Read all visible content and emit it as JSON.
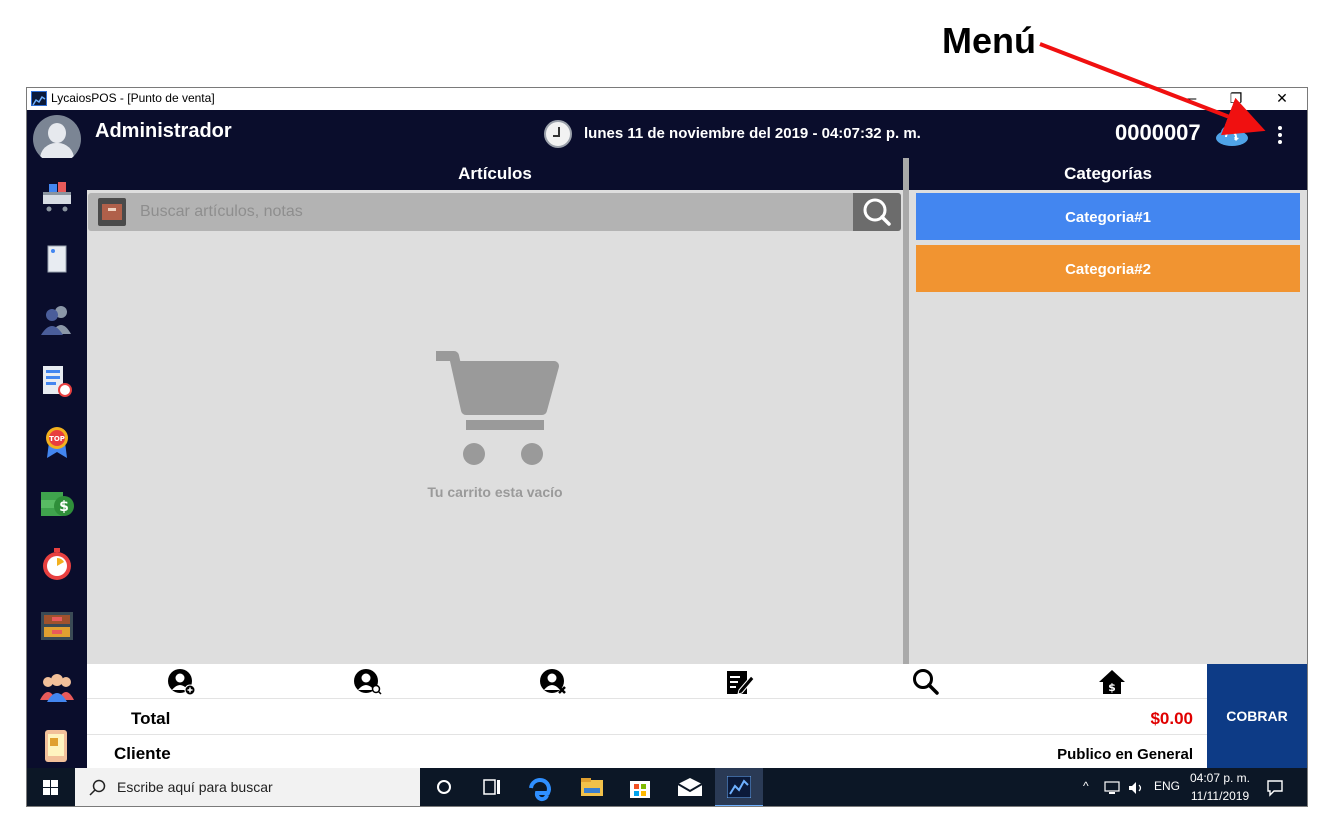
{
  "annotation": {
    "label": "Menú"
  },
  "window": {
    "title": "LycaiosPOS - [Punto de venta]",
    "controls": {
      "minimize": "—",
      "maximize": "❐",
      "close": "✕"
    }
  },
  "header": {
    "user": "Administrador",
    "datetime": "lunes 11 de noviembre del 2019 - 04:07:32 p. m.",
    "ticket_number": "0000007"
  },
  "sidebar": {
    "items": [
      "shopping-cart-icon",
      "document-icon",
      "users-icon",
      "report-clock-icon",
      "top-badge-icon",
      "money-icon",
      "stopwatch-icon",
      "inventory-icon",
      "clients-icon",
      "mobile-icon"
    ]
  },
  "articles": {
    "title": "Artículos",
    "search_placeholder": "Buscar artículos, notas",
    "empty_text": "Tu carrito esta vacío"
  },
  "categories": {
    "title": "Categorías",
    "items": [
      {
        "label": "Categoria#1",
        "color": "#4386f0"
      },
      {
        "label": "Categoria#2",
        "color": "#f19431"
      }
    ]
  },
  "actions": [
    "add-customer-icon",
    "search-customer-icon",
    "remove-customer-icon",
    "edit-note-icon",
    "search-icon",
    "house-dollar-icon"
  ],
  "totals": {
    "total_label": "Total",
    "total_value": "$0.00",
    "client_label": "Cliente",
    "client_value": "Publico en General",
    "charge_button": "COBRAR"
  },
  "taskbar": {
    "search_text": "Escribe aquí para buscar",
    "language": "ENG",
    "time": "04:07 p. m.",
    "date": "11/11/2019"
  },
  "colors": {
    "navy": "#0a0d2c",
    "cobrar": "#0d3b86",
    "total_red": "#e00000"
  }
}
